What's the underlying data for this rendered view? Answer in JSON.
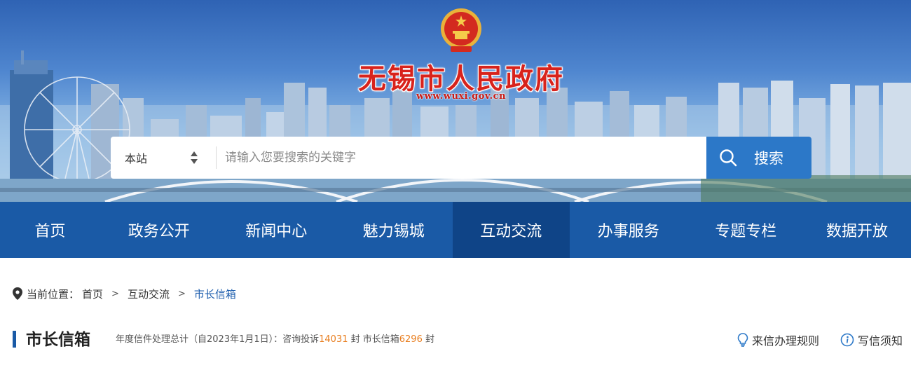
{
  "header": {
    "site_title": "无锡市人民政府",
    "site_url": "www.wuxi.gov.cn",
    "emblem_icon": "national-emblem-icon"
  },
  "search": {
    "scope_value": "本站",
    "placeholder": "请输入您要搜索的关键字",
    "button_label": "搜索",
    "button_color": "#2c78c8"
  },
  "nav": {
    "color": "#1a5aa6",
    "active_color": "#0f4487",
    "items": [
      {
        "label": "首页"
      },
      {
        "label": "政务公开"
      },
      {
        "label": "新闻中心"
      },
      {
        "label": "魅力锡城"
      },
      {
        "label": "互动交流",
        "active": true
      },
      {
        "label": "办事服务"
      },
      {
        "label": "专题专栏"
      },
      {
        "label": "数据开放"
      }
    ]
  },
  "breadcrumb": {
    "prefix": "当前位置：",
    "items": [
      "首页",
      "互动交流",
      "市长信箱"
    ],
    "separator": ">"
  },
  "section": {
    "title": "市长信箱",
    "stats": {
      "lead": "年度信件处理总计（自2023年1月1日）：咨询投诉",
      "complaints_count": "14031",
      "mid": " 封 市长信箱",
      "mailbox_count": "6296",
      "tail": " 封"
    },
    "links": {
      "rules": "来信办理规则",
      "notice": "写信须知"
    }
  }
}
